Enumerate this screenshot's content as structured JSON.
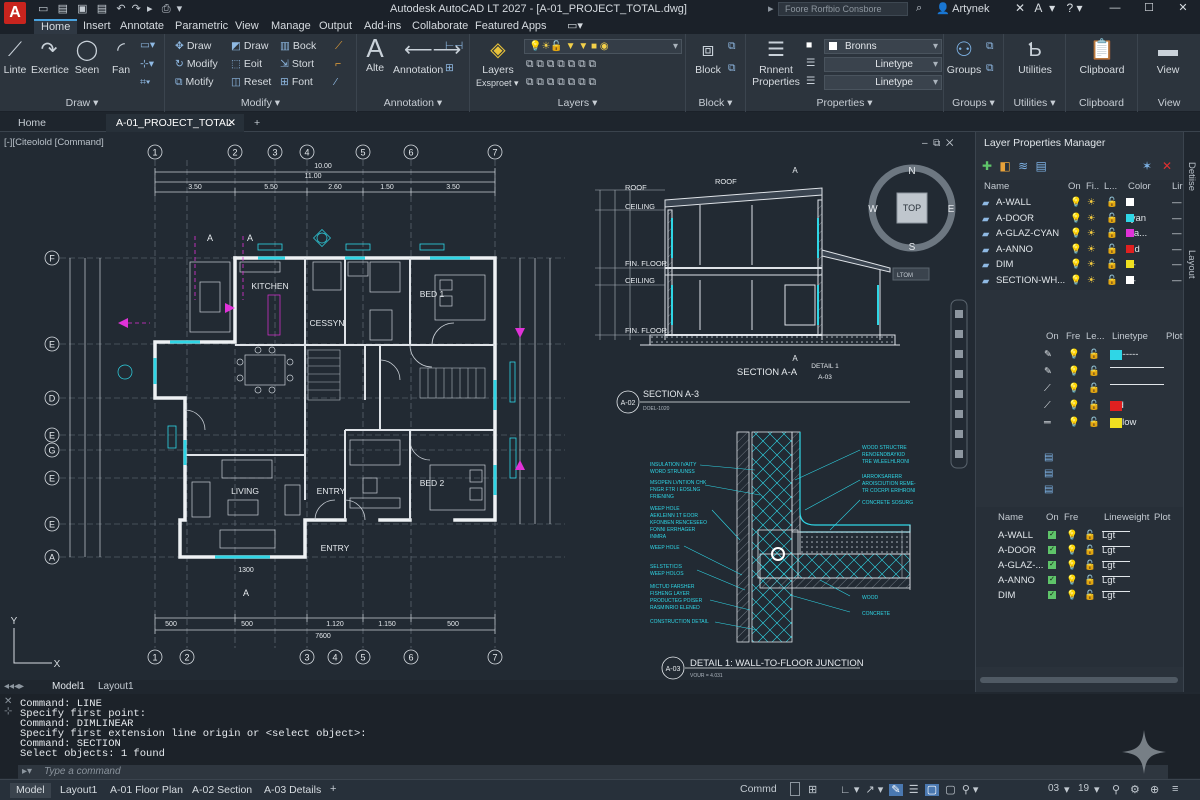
{
  "app": {
    "title": "Autodesk AutoCAD LT 2027 - [A-01_PROJECT_TOTAL.dwg]",
    "search_placeholder": "Foore Rorfbio Consbore",
    "user": "Artynek",
    "logo": "A"
  },
  "ribbon_tabs": [
    "Home",
    "Insert",
    "Annotate",
    "Parametric",
    "View",
    "Manage",
    "Output",
    "Add-ins",
    "Collaborate",
    "Featured Apps"
  ],
  "ribbon": {
    "draw": {
      "label": "Draw",
      "linte": "Linte",
      "exertice": "Exertice",
      "seen": "Seen",
      "fan": "Fan"
    },
    "modify": {
      "label": "Modify",
      "draw1": "Draw",
      "draw2": "Draw",
      "bock": "Bock",
      "modify": "Modify",
      "edit": "Eoit",
      "stort": "Stort",
      "motify": "Motify",
      "reset": "Reset",
      "font": "Font"
    },
    "annotation": {
      "label": "Annotation",
      "alte": "Alte",
      "annotation": "Annotation"
    },
    "layers": {
      "label": "Layers",
      "layers": "Layers",
      "exsproet": "Exsproet"
    },
    "block": {
      "label": "Block",
      "block": "Block"
    },
    "properties": {
      "label": "Properties",
      "rnnent": "Rnnent",
      "properties": "Properties",
      "color_dd": "Bronns",
      "linetype1": "Linetype",
      "linetype2": "Linetype"
    },
    "groups": {
      "label": "Groups",
      "groups": "Groups"
    },
    "utilities": {
      "label": "Utilities",
      "utilities": "Utilities"
    },
    "clipboard": {
      "label": "Clipboard",
      "clipboard": "Clipboard"
    },
    "view": {
      "label": "View",
      "view": "View"
    }
  },
  "doc_tabs": {
    "home": "Home",
    "active": "A-01_PROJECT_TOTAL"
  },
  "viewport_label": "[-][Citeolold [Command]",
  "drawing": {
    "grid_top": [
      "1",
      "2",
      "3",
      "4",
      "5",
      "6",
      "7"
    ],
    "grid_bottom": [
      "1",
      "2",
      "3",
      "4",
      "5",
      "6",
      "7"
    ],
    "grid_left": [
      "F",
      "E",
      "D",
      "E",
      "G",
      "E",
      "E",
      "A"
    ],
    "dims_top": [
      "10.00",
      "11.00",
      "3.50",
      "5.50",
      "2.60",
      "1.50",
      "3.50"
    ],
    "dims_bottom": [
      "500",
      "500",
      "1.120",
      "1.150",
      "500",
      "7600"
    ],
    "rooms": [
      "KITCHEN",
      "CESSYN",
      "BED 1",
      "LIVING",
      "ENTRY",
      "BED 2",
      "ENTRY"
    ],
    "section_a": "A",
    "dim_1300": "1300",
    "section_title": "SECTION A-A",
    "section_labels": [
      "ROOF",
      "ROOF",
      "CEILING",
      "FIN. FLOOR",
      "CEILING",
      "FIN. FLOOR"
    ],
    "section_ref_top": "A",
    "detail_bubble": [
      "DETAIL 1",
      "A-03"
    ],
    "sec_a02_title": "SECTION  A-3",
    "sec_a02_ref": "A-02",
    "sec_a02_sub": "DOEL-1020",
    "detail_title": "DETAIL 1: WALL-TO-FLOOR JUNCTION",
    "detail_ref": "A-03",
    "detail_sub": "VOUR = 4.031",
    "detail_notes_left": [
      "INSULATION IVAITY",
      "WORD STRUUNSS",
      "MSOPEN LVNTION CHK",
      "FNGR FTR I EOSLNG",
      "FRIENING",
      "WEEP HOLE",
      "AEKLEINN 1T EOOR",
      "KFONBEN RENCESEEO",
      "FONNI ERRHAGER",
      "INMRA",
      "WEEP HOLE",
      "SELSTETICIS",
      "WEEP HOLOS",
      "MICTUD FARSHER",
      "FISHENG LAYER",
      "PRODUCTEG POISER",
      "RASMINRIO ELENED",
      "CONSTRUCTION DETAIL"
    ],
    "detail_notes_right": [
      "WOOD STRUCTRE",
      "RENOENDBAYKID",
      "TRE WLEELHLRONI",
      "IARROKSARERR",
      "AROISCIUTION REME-",
      "TR COCRPI ERIHRONI",
      "CONCRETE SOSURG",
      "WOOD",
      "CONCRETE"
    ],
    "compass": {
      "n": "N",
      "s": "S",
      "e": "E",
      "w": "W",
      "top": "TOP",
      "wcs": "LTOM"
    },
    "ucs": {
      "y": "Y",
      "x": "X"
    }
  },
  "layer_manager": {
    "title": "Layer Properties Manager",
    "headers": [
      "Name",
      "On",
      "Fi..",
      "L...",
      "Color",
      "Lir"
    ],
    "layers": [
      {
        "name": "A-WALL",
        "color_name": "7",
        "color": "#ffffff"
      },
      {
        "name": "A-DOOR",
        "color_name": "cyan",
        "color": "#2fd6e6"
      },
      {
        "name": "A-GLAZ-CYAN",
        "color_name": "ma...",
        "color": "#e032d8"
      },
      {
        "name": "A-ANNO",
        "color_name": "red",
        "color": "#e02020"
      },
      {
        "name": "DIM",
        "color_name": "—",
        "color": "#f0e020"
      },
      {
        "name": "SECTION-WH...",
        "color_name": "—",
        "color": "#ffffff"
      }
    ],
    "sub_headers": [
      "On",
      "Fre",
      "Le...",
      "Linetype",
      "Plot"
    ],
    "sub_rows": [
      {
        "linetype": "---------",
        "color": "#2fd6e6",
        "show": true
      },
      {
        "linetype": "",
        "color": "",
        "show": false
      },
      {
        "linetype": "",
        "color": "",
        "show": false
      },
      {
        "linetype": "red",
        "color": "#e02020",
        "show": true
      },
      {
        "linetype": "yellow",
        "color": "#f0e020",
        "show": true
      }
    ],
    "lw_headers": [
      "Name",
      "On",
      "Fre",
      "Lineweight",
      "Plot"
    ],
    "lw_rows": [
      {
        "name": "A-WALL",
        "lw": "Lgt"
      },
      {
        "name": "A-DOOR",
        "lw": "Lgt"
      },
      {
        "name": "A-GLAZ-...",
        "lw": "Lgt"
      },
      {
        "name": "A-ANNO",
        "lw": "Lgt"
      },
      {
        "name": "DIM",
        "lw": "Lgt"
      }
    ],
    "side_tabs": [
      "Detiise",
      "Layout"
    ]
  },
  "model_tabs": [
    "Model1",
    "Layout1"
  ],
  "command": {
    "lines": [
      "Command: LINE",
      "Specify first point:",
      "Command: DIMLINEAR",
      "Specify first extension line origin or <select object>:",
      "Command: SECTION",
      "Select objects: 1 found"
    ],
    "placeholder": "Type a command"
  },
  "status_tabs": [
    "Model",
    "Layout1",
    "A-01 Floor Plan",
    "A-02 Section",
    "A-03 Details"
  ],
  "status_right": {
    "cmd": "Commd",
    "scale1": "03",
    "scale2": "19"
  }
}
